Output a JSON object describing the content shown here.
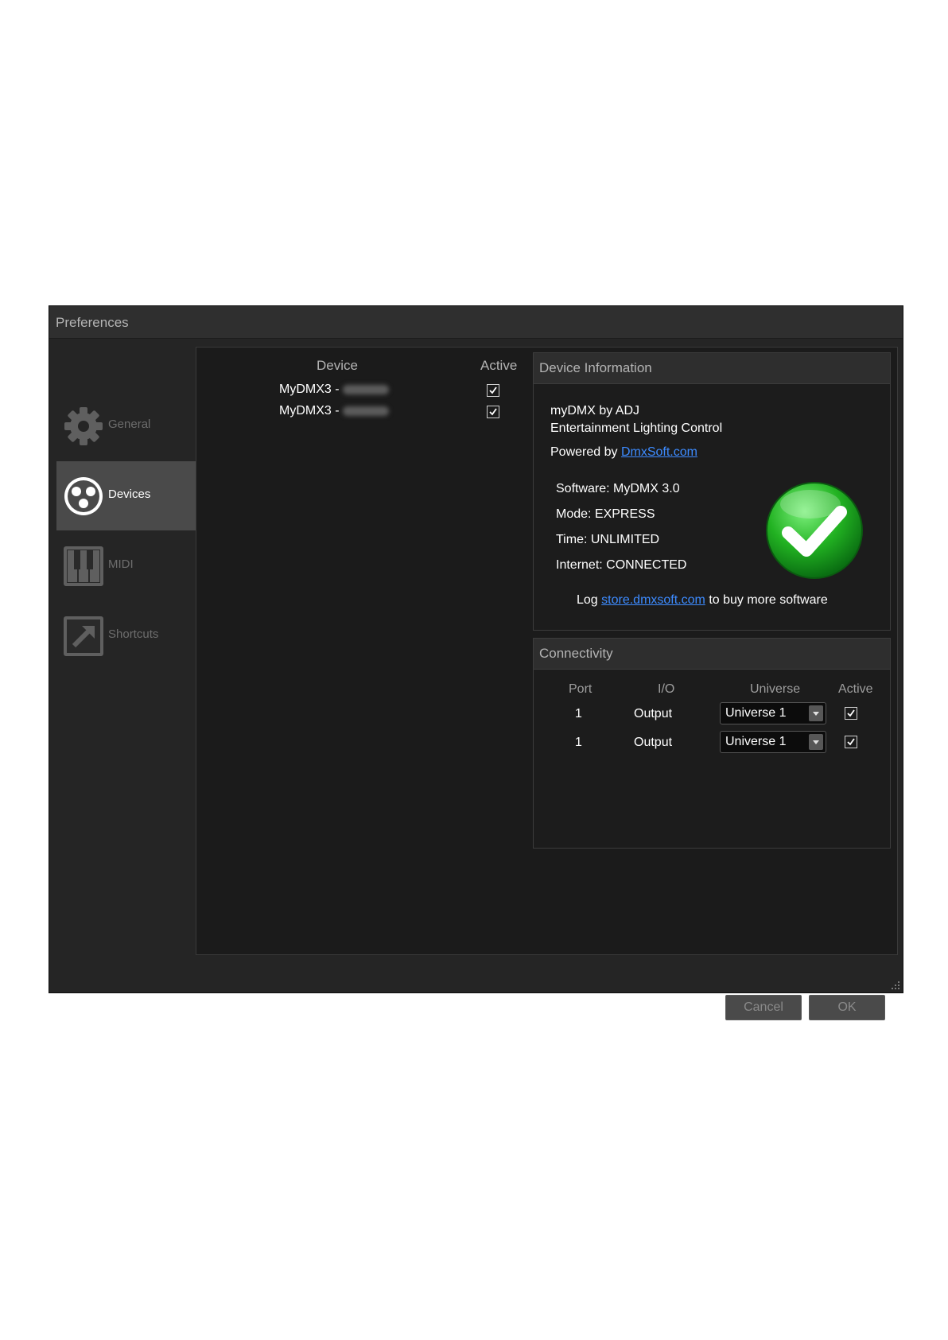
{
  "window": {
    "title": "Preferences"
  },
  "sidebar": {
    "items": [
      {
        "label": "General",
        "icon": "gear-icon"
      },
      {
        "label": "Devices",
        "icon": "dmx-connector-icon",
        "active": true
      },
      {
        "label": "MIDI",
        "icon": "piano-keys-icon"
      },
      {
        "label": "Shortcuts",
        "icon": "shortcut-arrow-icon"
      }
    ]
  },
  "devices": {
    "headers": {
      "device": "Device",
      "active": "Active"
    },
    "rows": [
      {
        "name": "MyDMX3 -",
        "active": true
      },
      {
        "name": "MyDMX3 -",
        "active": true
      }
    ]
  },
  "device_info": {
    "title": "Device Information",
    "line1": "myDMX by ADJ",
    "line2": "Entertainment Lighting Control",
    "powered_prefix": "Powered by",
    "powered_link": "DmxSoft.com",
    "software": "Software: MyDMX 3.0",
    "mode": "Mode: EXPRESS",
    "time": "Time: UNLIMITED",
    "internet": "Internet: CONNECTED",
    "log_prefix": "Log",
    "log_link": "store.dmxsoft.com",
    "log_suffix": "to buy more software",
    "status_icon": "green-check-icon"
  },
  "connectivity": {
    "title": "Connectivity",
    "headers": {
      "port": "Port",
      "io": "I/O",
      "universe": "Universe",
      "active": "Active"
    },
    "rows": [
      {
        "port": "1",
        "io": "Output",
        "universe": "Universe 1",
        "active": true
      },
      {
        "port": "1",
        "io": "Output",
        "universe": "Universe 1",
        "active": true
      }
    ]
  },
  "buttons": {
    "cancel": "Cancel",
    "ok": "OK"
  },
  "colors": {
    "link": "#3d8bff",
    "check_green": "#2db82d",
    "background": "#252525"
  }
}
